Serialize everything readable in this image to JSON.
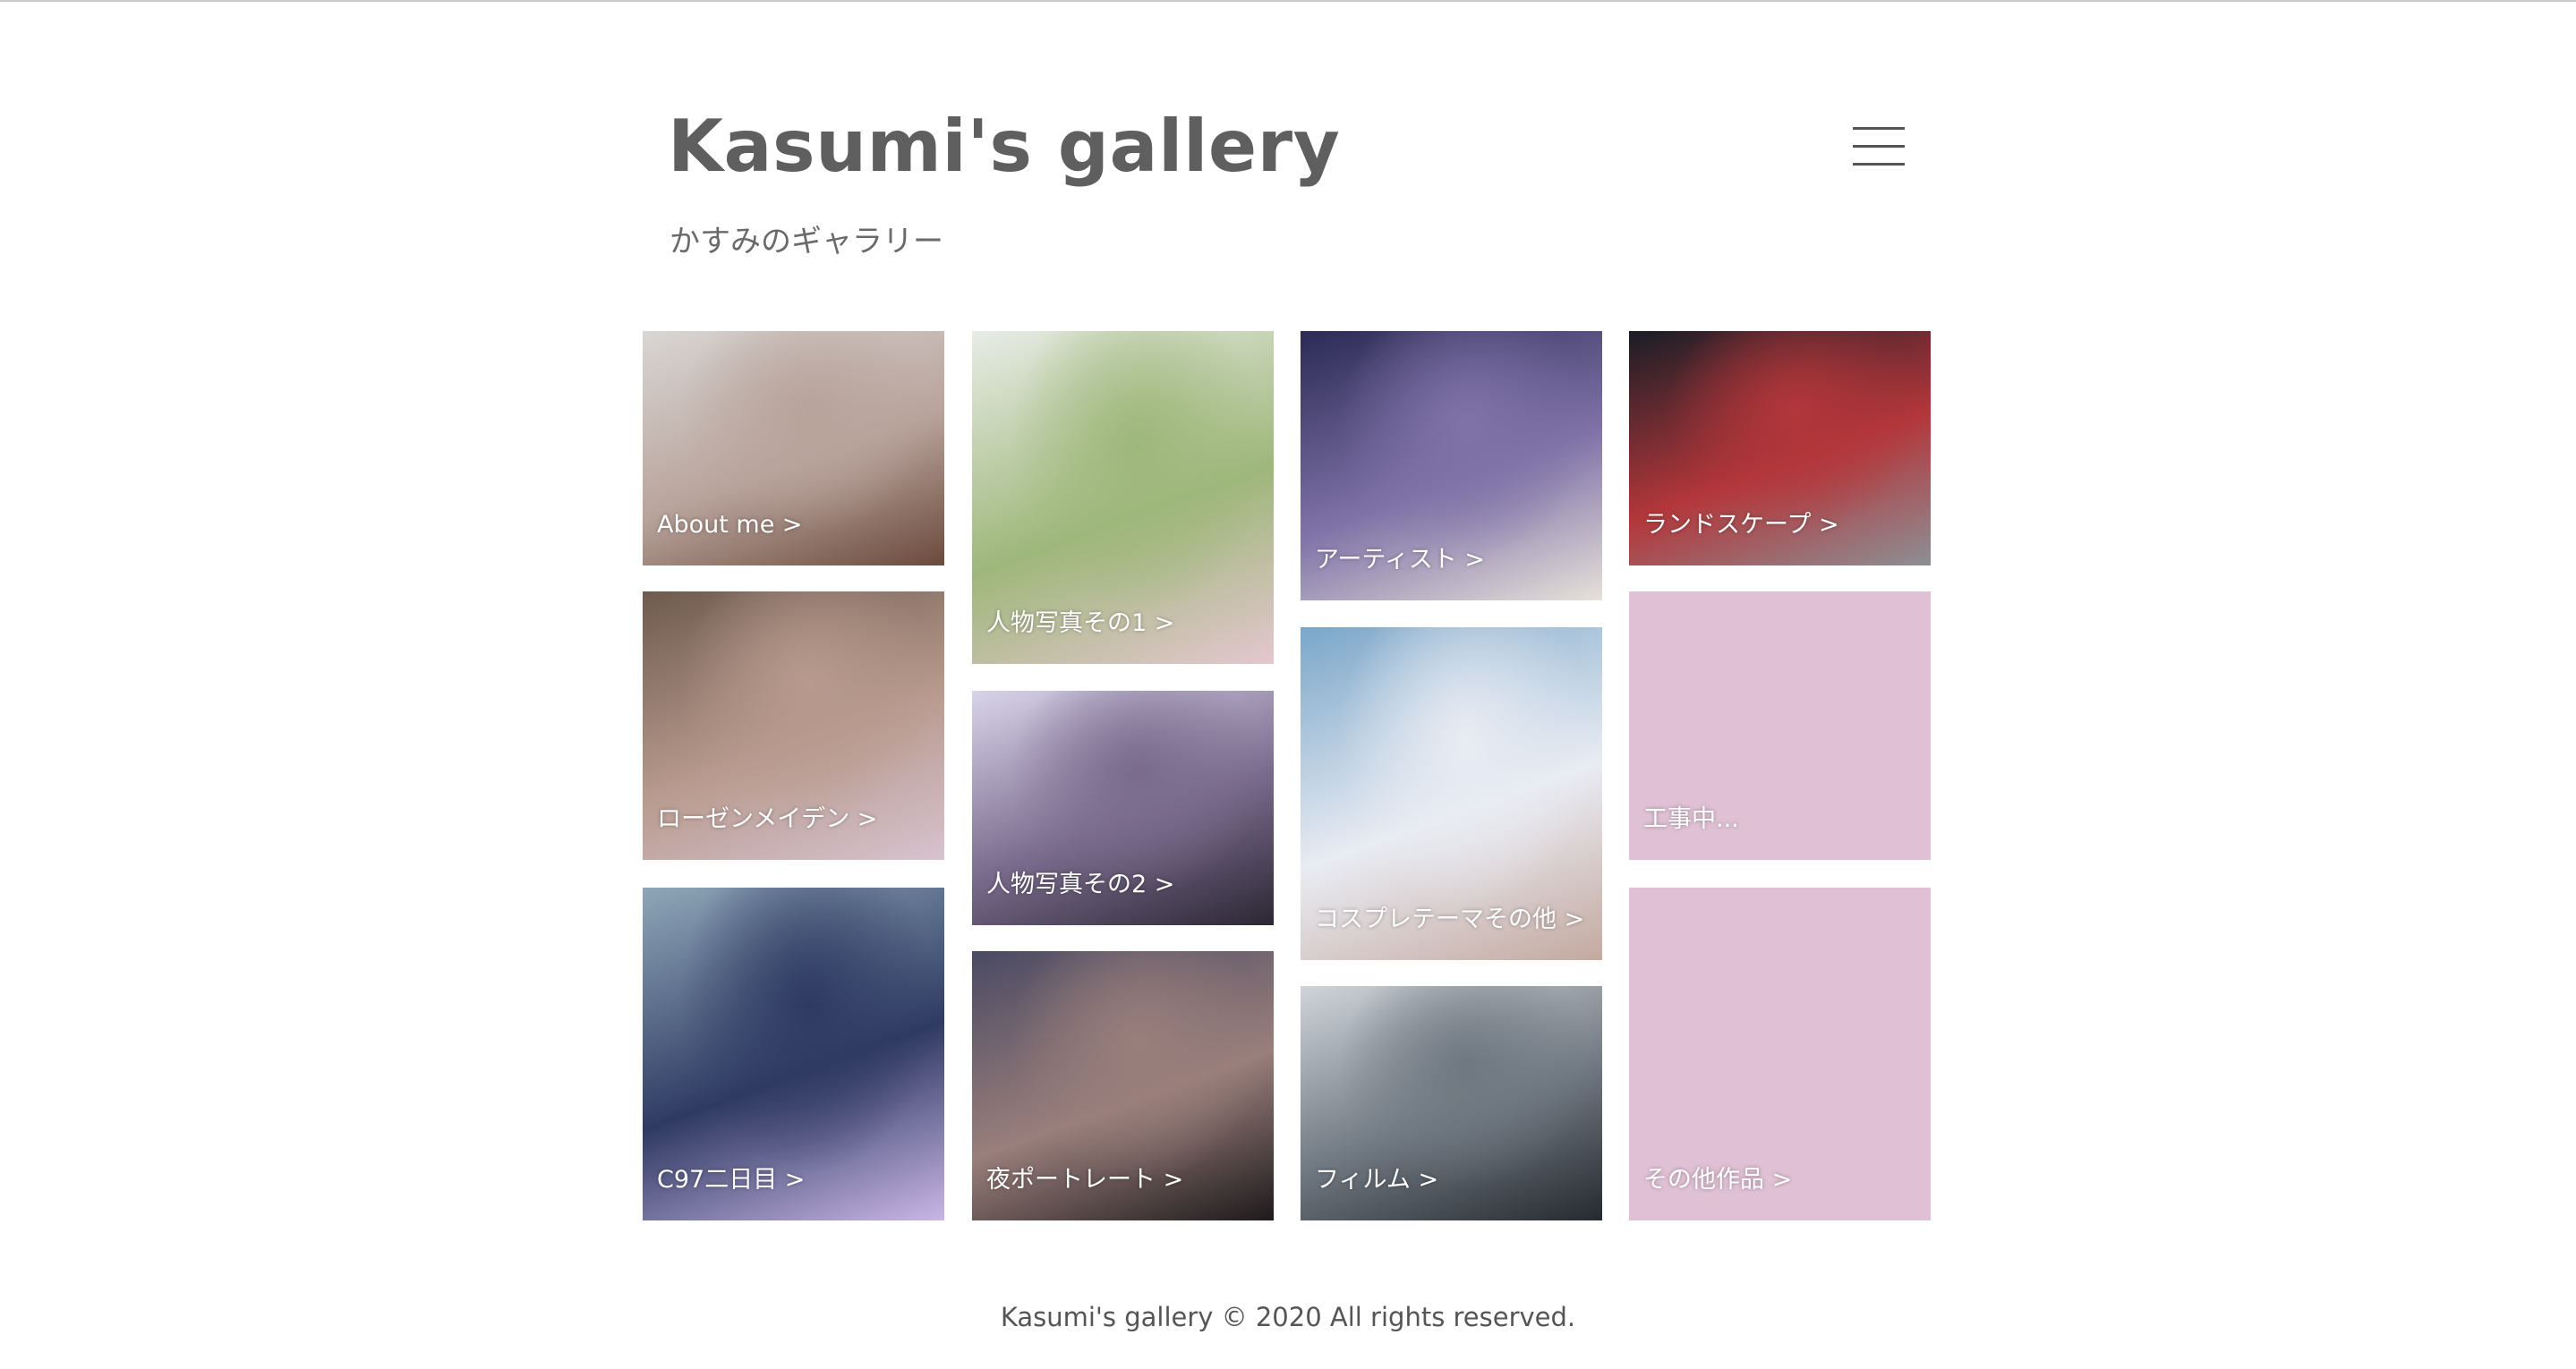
{
  "site": {
    "title": "Kasumi's gallery",
    "subtitle": "かすみのギャラリー",
    "menu_icon": "hamburger-menu-icon"
  },
  "gallery": {
    "tiles": [
      {
        "label": "About me >",
        "kind": "photo",
        "palette": [
          "#d9d6d4",
          "#b8a39b",
          "#6b4a3d"
        ]
      },
      {
        "label": "ローゼンメイデン >",
        "kind": "photo",
        "palette": [
          "#6e5a4e",
          "#b89a8e",
          "#d7c3cf"
        ]
      },
      {
        "label": "C97二日目 >",
        "kind": "photo",
        "palette": [
          "#8fa7b8",
          "#2f3a63",
          "#c9b6e6"
        ]
      },
      {
        "label": "人物写真その1 >",
        "kind": "photo",
        "palette": [
          "#e8ece6",
          "#9eb77a",
          "#e4c7cf"
        ]
      },
      {
        "label": "人物写真その2 >",
        "kind": "photo",
        "palette": [
          "#d9d4ea",
          "#7a6b8d",
          "#2c2734"
        ]
      },
      {
        "label": "夜ポートレート >",
        "kind": "photo",
        "palette": [
          "#4a4a63",
          "#9a7f7b",
          "#1e1a1c"
        ]
      },
      {
        "label": "アーティスト >",
        "kind": "photo",
        "palette": [
          "#2b2a55",
          "#8073a8",
          "#e6e1da"
        ]
      },
      {
        "label": "コスプレテーマその他 >",
        "kind": "photo",
        "palette": [
          "#7aa6c9",
          "#e9ecf3",
          "#c4a9a0"
        ]
      },
      {
        "label": "フィルム >",
        "kind": "photo",
        "palette": [
          "#cfd4da",
          "#6f7780",
          "#262a30"
        ]
      },
      {
        "label": "ランドスケープ >",
        "kind": "photo",
        "palette": [
          "#1a1d26",
          "#b3363a",
          "#8c8f94"
        ]
      },
      {
        "label": "工事中...",
        "kind": "placeholder",
        "palette": [
          "#dfc0d4"
        ]
      },
      {
        "label": "その他作品 >",
        "kind": "placeholder",
        "palette": [
          "#dfc0d4"
        ]
      }
    ]
  },
  "footer": {
    "text": "Kasumi's gallery © 2020 All rights reserved."
  }
}
